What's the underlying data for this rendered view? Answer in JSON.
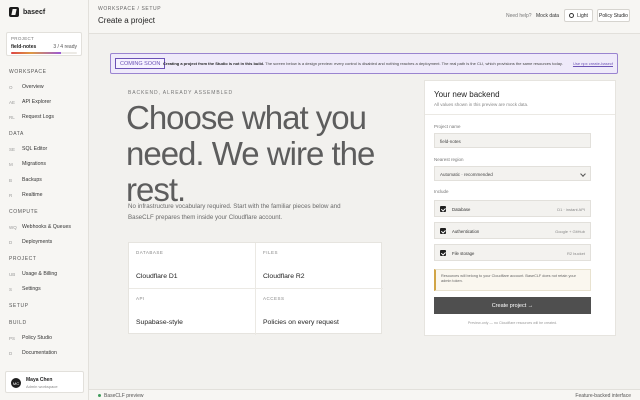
{
  "brand": {
    "name": "basecf"
  },
  "project": {
    "label": "PROJECT",
    "name": "field-notes",
    "ready": "3 / 4 ready",
    "progress": 0.75
  },
  "sidebar": {
    "sections": [
      {
        "label": "WORKSPACE",
        "items": [
          {
            "abbr": "O",
            "label": "Overview"
          },
          {
            "abbr": "AE",
            "label": "API Explorer"
          },
          {
            "abbr": "RL",
            "label": "Request Logs"
          }
        ]
      },
      {
        "label": "DATA",
        "items": [
          {
            "abbr": "SE",
            "label": "SQL Editor"
          },
          {
            "abbr": "M",
            "label": "Migrations"
          },
          {
            "abbr": "B",
            "label": "Backups"
          },
          {
            "abbr": "R",
            "label": "Realtime"
          }
        ]
      },
      {
        "label": "COMPUTE",
        "items": [
          {
            "abbr": "WQ",
            "label": "Webhooks & Queues"
          },
          {
            "abbr": "D",
            "label": "Deployments"
          }
        ]
      },
      {
        "label": "PROJECT",
        "items": [
          {
            "abbr": "UB",
            "label": "Usage & Billing"
          },
          {
            "abbr": "S",
            "label": "Settings"
          }
        ]
      },
      {
        "label": "SETUP",
        "items": []
      },
      {
        "label": "BUILD",
        "items": [
          {
            "abbr": "PS",
            "label": "Policy Studio"
          },
          {
            "abbr": "D",
            "label": "Documentation"
          }
        ]
      }
    ]
  },
  "user": {
    "initials": "MC",
    "name": "Maya Chen",
    "sub": "Admin workspace"
  },
  "header": {
    "breadcrumb": "WORKSPACE / SETUP",
    "title": "Create a project",
    "help": "Need help?",
    "mock": "Mock data",
    "light": "Light",
    "studio": "Policy Studio"
  },
  "banner": {
    "badge": "COMING SOON",
    "bold": "Creating a project from the Studio is not in this build.",
    "text": " The screen below is a design preview: every control is disabled and nothing reaches a deployment. The real path is the CLI, which provisions the same resources today.",
    "link": "Use npx create-basecf"
  },
  "main": {
    "eyebrow": "BACKEND, ALREADY ASSEMBLED",
    "hero": [
      "Choose what you",
      "need. We wire the",
      "rest."
    ],
    "description": "No infrastructure vocabulary required. Start with the familiar pieces below and BaseCLF prepares them inside your Cloudflare account.",
    "stack": [
      {
        "label": "DATABASE",
        "value": "Cloudflare D1"
      },
      {
        "label": "FILES",
        "value": "Cloudflare R2"
      },
      {
        "label": "API",
        "value": "Supabase-style"
      },
      {
        "label": "ACCESS",
        "value": "Policies on every request"
      }
    ]
  },
  "form": {
    "title": "Your new backend",
    "subtitle": "All values shown in this preview are mock data.",
    "name_label": "Project name",
    "name_value": "field-notes",
    "region_label": "Nearest region",
    "region_value": "Automatic · recommended",
    "include_label": "Include",
    "includes": [
      {
        "name": "Database",
        "value": "D1 · instant API"
      },
      {
        "name": "Authentication",
        "value": "Google + GitHub"
      },
      {
        "name": "File storage",
        "value": "R2 bucket"
      }
    ],
    "note": "Resources will belong to your Cloudflare account. BaseCLF does not retain your admin token.",
    "create": "Create project →",
    "fine": "Preview-only — no Cloudflare resources will be created."
  },
  "footer": {
    "left": "BaseCLF preview",
    "right": "Feature-backed interface"
  }
}
